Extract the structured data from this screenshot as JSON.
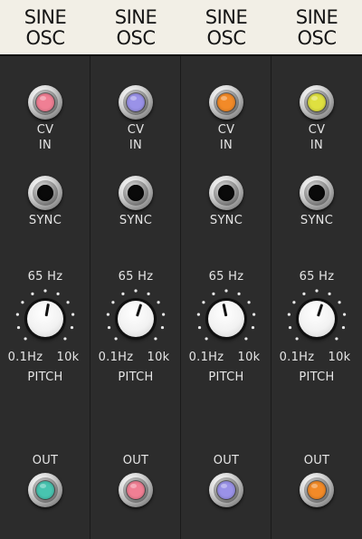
{
  "modules": [
    {
      "title1": "SINE",
      "title2": "OSC",
      "cv_label1": "CV",
      "cv_label2": "IN",
      "sync_label": "SYNC",
      "freq_readout": "65 Hz",
      "range_min": "0.1Hz",
      "range_max": "10k",
      "pitch_label": "PITCH",
      "out_label": "OUT",
      "cv_led_color": "#f07f94",
      "out_led_color": "#48c4b0",
      "knob_icon": "knob-icon"
    },
    {
      "title1": "SINE",
      "title2": "OSC",
      "cv_label1": "CV",
      "cv_label2": "IN",
      "sync_label": "SYNC",
      "freq_readout": "65 Hz",
      "range_min": "0.1Hz",
      "range_max": "10k",
      "pitch_label": "PITCH",
      "out_label": "OUT",
      "cv_led_color": "#9a92e8",
      "out_led_color": "#f07f94",
      "knob_icon": "knob-icon"
    },
    {
      "title1": "SINE",
      "title2": "OSC",
      "cv_label1": "CV",
      "cv_label2": "IN",
      "sync_label": "SYNC",
      "freq_readout": "65 Hz",
      "range_min": "0.1Hz",
      "range_max": "10k",
      "pitch_label": "PITCH",
      "out_label": "OUT",
      "cv_led_color": "#f28a28",
      "out_led_color": "#9a92e8",
      "knob_icon": "knob-icon"
    },
    {
      "title1": "SINE",
      "title2": "OSC",
      "cv_label1": "CV",
      "cv_label2": "IN",
      "sync_label": "SYNC",
      "freq_readout": "65 Hz",
      "range_min": "0.1Hz",
      "range_max": "10k",
      "pitch_label": "PITCH",
      "out_label": "OUT",
      "cv_led_color": "#dfe040",
      "out_led_color": "#f28a28",
      "knob_icon": "knob-icon"
    }
  ],
  "theme": {
    "panel": "#2c2c2c",
    "header": "#f2efe6",
    "label": "#e6e6e6"
  }
}
